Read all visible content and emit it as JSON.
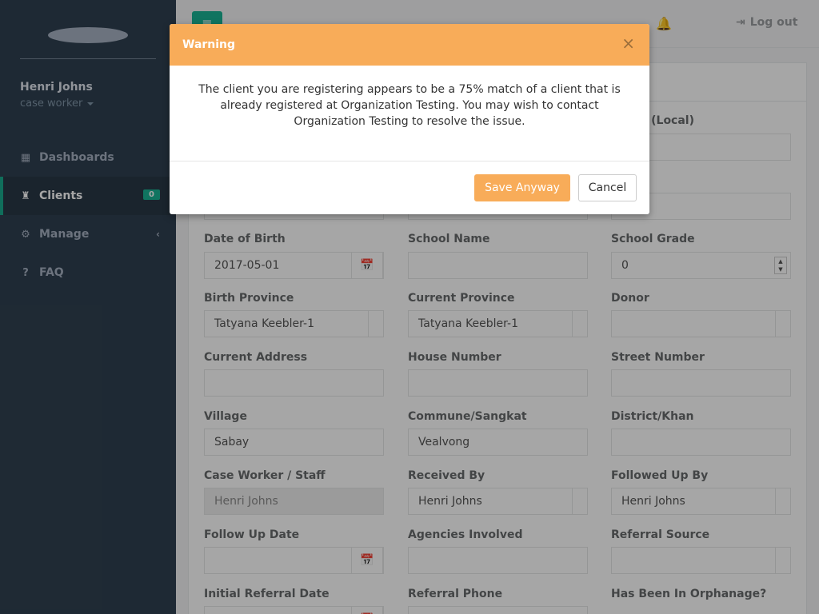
{
  "sidebar": {
    "user_name": "Henri Johns",
    "user_role": "case worker",
    "items": [
      {
        "label": "Dashboards",
        "icon": "grid-icon"
      },
      {
        "label": "Clients",
        "icon": "person-icon",
        "badge": "0"
      },
      {
        "label": "Manage",
        "icon": "gears-icon"
      },
      {
        "label": "FAQ",
        "icon": "question-circle-icon"
      }
    ]
  },
  "topbar": {
    "menu_icon": "≡",
    "logout_label": "Log out"
  },
  "form": {
    "name_local": {
      "label": "Name (Local)"
    },
    "date_of_birth": {
      "label": "Date of Birth",
      "value": "2017-05-01"
    },
    "school_name": {
      "label": "School Name",
      "value": ""
    },
    "school_grade": {
      "label": "School Grade",
      "value": "0"
    },
    "birth_province": {
      "label": "Birth Province",
      "value": "Tatyana Keebler-1"
    },
    "current_province": {
      "label": "Current Province",
      "value": "Tatyana Keebler-1"
    },
    "donor": {
      "label": "Donor",
      "value": ""
    },
    "current_address": {
      "label": "Current Address",
      "value": ""
    },
    "house_number": {
      "label": "House Number",
      "value": ""
    },
    "street_number": {
      "label": "Street Number",
      "value": ""
    },
    "village": {
      "label": "Village",
      "value": "Sabay"
    },
    "commune": {
      "label": "Commune/Sangkat",
      "value": "Vealvong"
    },
    "district": {
      "label": "District/Khan",
      "value": ""
    },
    "case_worker": {
      "label": "Case Worker / Staff",
      "value": "Henri Johns"
    },
    "received_by": {
      "label": "Received By",
      "value": "Henri Johns"
    },
    "followed_up_by": {
      "label": "Followed Up By",
      "value": "Henri Johns"
    },
    "follow_up_date": {
      "label": "Follow Up Date",
      "value": ""
    },
    "agencies_involved": {
      "label": "Agencies Involved",
      "value": ""
    },
    "referral_source": {
      "label": "Referral Source",
      "value": ""
    },
    "initial_referral_date": {
      "label": "Initial Referral Date"
    },
    "referral_phone": {
      "label": "Referral Phone"
    },
    "orphanage": {
      "label": "Has Been In Orphanage?"
    }
  },
  "modal": {
    "title": "Warning",
    "close": "×",
    "message": "The client you are registering appears to be a 75% match of a client that is already registered at Organization Testing. You may wish to contact Organization Testing to resolve the issue.",
    "save_label": "Save Anyway",
    "cancel_label": "Cancel"
  },
  "colors": {
    "sidebar_bg": "#2f4050",
    "accent": "#1ab394",
    "warning": "#f8ac59"
  }
}
